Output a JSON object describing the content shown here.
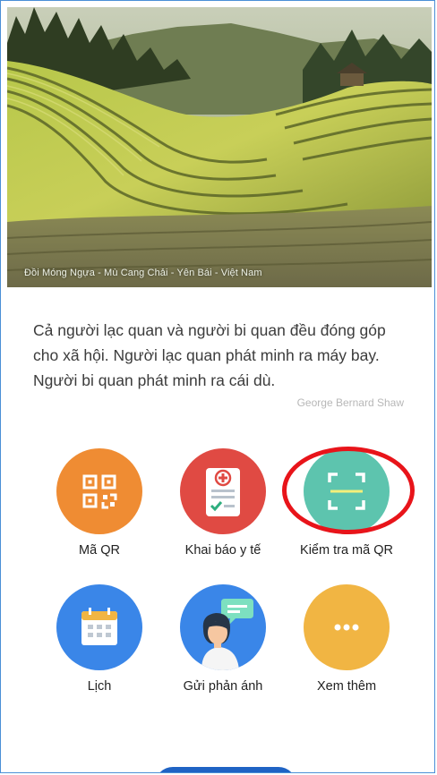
{
  "hero": {
    "caption": "Đồi Móng Ngựa - Mù Cang Chải - Yên Bái - Việt Nam"
  },
  "quote": {
    "text": "Cả người lạc quan và người bi quan đều đóng góp cho xã hội. Người lạc quan phát minh ra máy bay. Người bi quan phát minh ra cái dù.",
    "author": "George Bernard Shaw"
  },
  "tiles": [
    {
      "label": "Mã QR",
      "icon": "qr-code-icon",
      "color": "#ef8c33"
    },
    {
      "label": "Khai báo y tế",
      "icon": "medical-form-icon",
      "color": "#e04a43"
    },
    {
      "label": "Kiểm tra mã QR",
      "icon": "qr-scan-icon",
      "color": "#5dc4ae"
    },
    {
      "label": "Lịch",
      "icon": "calendar-icon",
      "color": "#3a86e8"
    },
    {
      "label": "Gửi phản ánh",
      "icon": "feedback-person-icon",
      "color": "#3a86e8"
    },
    {
      "label": "Xem thêm",
      "icon": "more-dots-icon",
      "color": "#f1b543"
    }
  ],
  "colors": {
    "frame_border": "#4a8fd6",
    "highlight": "#e8141a",
    "primary_button": "#1f63c4"
  }
}
